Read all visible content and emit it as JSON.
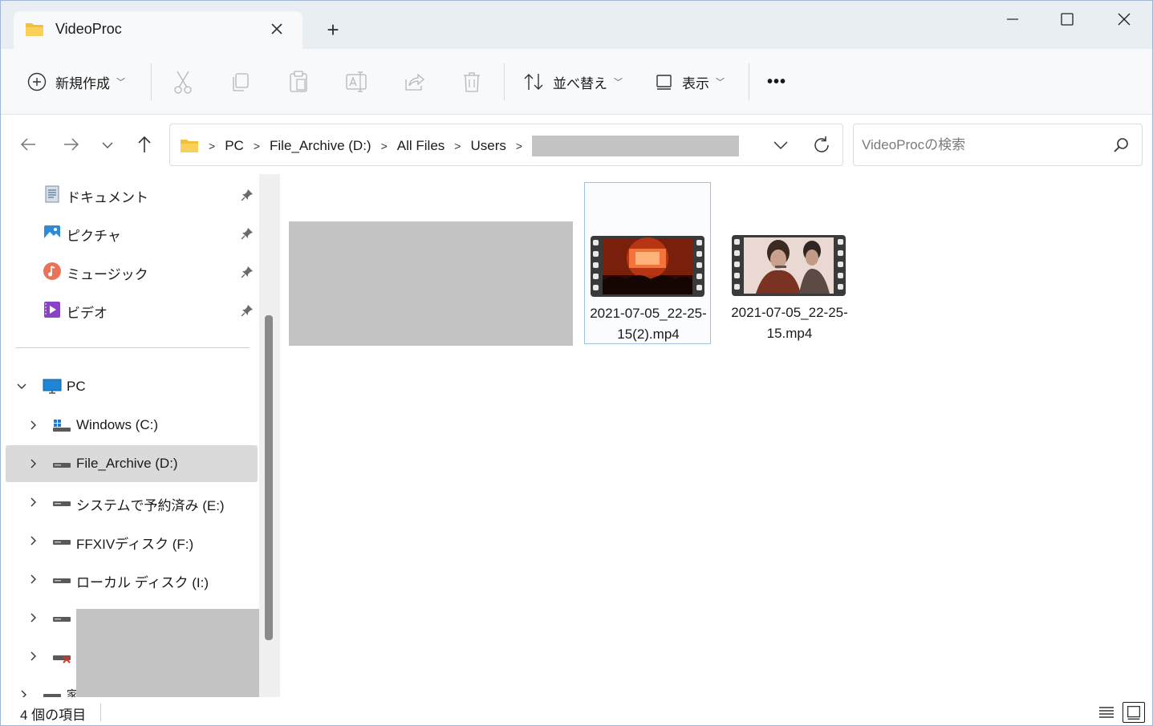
{
  "window": {
    "tab_title": "VideoProc",
    "new_tab_label": "+"
  },
  "toolbar": {
    "new_label": "新規作成",
    "sort_label": "並べ替え",
    "view_label": "表示",
    "more_label": "•••"
  },
  "address": {
    "crumbs": [
      "PC",
      "File_Archive (D:)",
      "All Files",
      "Users"
    ]
  },
  "search": {
    "placeholder": "VideoProcの検索"
  },
  "sidebar": {
    "quick_access": [
      {
        "label": "ドキュメント",
        "icon": "documents-icon"
      },
      {
        "label": "ピクチャ",
        "icon": "pictures-icon"
      },
      {
        "label": "ミュージック",
        "icon": "music-icon"
      },
      {
        "label": "ビデオ",
        "icon": "videos-icon"
      }
    ],
    "pc_label": "PC",
    "drives": [
      {
        "label": "Windows (C:)"
      },
      {
        "label": "File_Archive (D:)"
      },
      {
        "label": "システムで予約済み (E:)"
      },
      {
        "label": "FFXIVディスク (F:)"
      },
      {
        "label": "ローカル ディスク (I:)"
      }
    ],
    "selected_drive": "File_Archive (D:)",
    "partial_label": "家"
  },
  "files": [
    {
      "name": "2021-07-05_22-25-15(2).mp4",
      "selected": true
    },
    {
      "name": "2021-07-05_22-25-15.mp4",
      "selected": false
    }
  ],
  "status": {
    "item_count": "4 個の項目"
  },
  "colors": {
    "accent": "#0067c0",
    "folder": "#f3c03b",
    "selection": "#dadada"
  }
}
